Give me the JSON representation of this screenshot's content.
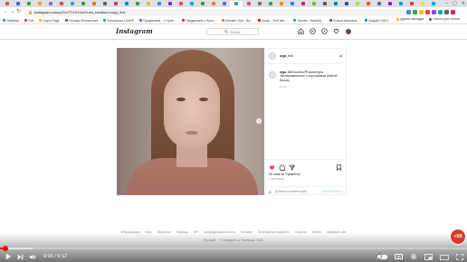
{
  "browser": {
    "url": "instagram.com/p/CU7TtYA7cbr/?utm_medium=copy_link",
    "tab_colors": [
      "#e34d4d",
      "#4267b2",
      "#3d9b3d",
      "#f2a31b",
      "#7b6bd6",
      "#e34d4d",
      "#1da1f2",
      "#3d9b3d",
      "#ff6a00",
      "#5f6368",
      "#e1306c",
      "#0088cc",
      "#3d9b3d",
      "#f4b400",
      "#4285f4",
      "#9c27b0",
      "#e34d4d",
      "#00acc1",
      "#3d9b3d",
      "#ff7043",
      "#5c6bc0",
      "#26a69a",
      "#ec407a",
      "#8d6e63",
      "#43a047",
      "#fb8c00",
      "#1e88e5",
      "#d81b60",
      "#7cb342",
      "#6d4c41",
      "#00897b",
      "#3949ab",
      "#c0ca33",
      "#f4511e",
      "#546e7a",
      "#8e24aa",
      "#039be5",
      "#e53935",
      "#fdd835",
      "#00acc1"
    ],
    "extension_colors": [
      "#4285f4",
      "#34a853",
      "#fbbc05",
      "#ea4335",
      "#7e57c2",
      "#26a69a",
      "#5f6368",
      "#e91e63"
    ],
    "bookmarks": [
      {
        "label": "Сервисы",
        "color": "#4285f4"
      },
      {
        "label": "Gmi",
        "color": "#ea4335"
      },
      {
        "label": "Logon Page",
        "color": "#fbbc05"
      },
      {
        "label": "Техника Monosenses",
        "color": "#4267b2"
      },
      {
        "label": "Фотошкола САКУЕ",
        "color": "#34a853"
      },
      {
        "label": "Продвигаем... с Нуля ...",
        "color": "#7e57c2"
      },
      {
        "label": "Продвигаем с Нуля...",
        "color": "#e91e63"
      },
      {
        "label": "Lifestyle Club - Ва...",
        "color": "#ff7043"
      },
      {
        "label": "Уроки - YouTube ...",
        "color": "#ff0000"
      },
      {
        "label": "Тестим - Всеобщ...",
        "color": "#26a69a"
      },
      {
        "label": "Статьи запросов...",
        "color": "#5f6368"
      },
      {
        "label": "Угадай! г.GEO...",
        "color": "#1e88e5"
      }
    ],
    "bookmarks_right": [
      {
        "label": "Другие закладки",
        "color": "#fbbc05"
      },
      {
        "label": "Список для чтения",
        "color": "#5f6368"
      }
    ]
  },
  "instagram": {
    "logo": "Instagram",
    "search_placeholder": "Поиск",
    "post": {
      "username": "olga_er3",
      "caption_user": "olga_er3",
      "caption_text": "#осень🥀#капитуры Экспериментоны с корочковым (Матой Бачка)",
      "time_ago": "9 нед.",
      "likes": "55 отметок \"Нравится\"",
      "date": "2 ОКТЯБРЯ",
      "comment_placeholder": "Добавьте комментарий...",
      "publish": "Опубликовать"
    },
    "footer_links": [
      "Информация",
      "Блог",
      "Вакансии",
      "Помощь",
      "API",
      "Конфиденциальность",
      "Условия",
      "Популярные аккаунты",
      "Хэштеги",
      "Места",
      "Instagram Lite"
    ],
    "footer_copy": [
      "Русский",
      "© Instagram от Facebook, 2021"
    ]
  },
  "player": {
    "progress_fraction": 0.012,
    "buffered_fraction": 0.07,
    "time_current": "0:06",
    "time_total": "9:12",
    "time_display": "0:06 / 9:12",
    "badge": "+50"
  }
}
